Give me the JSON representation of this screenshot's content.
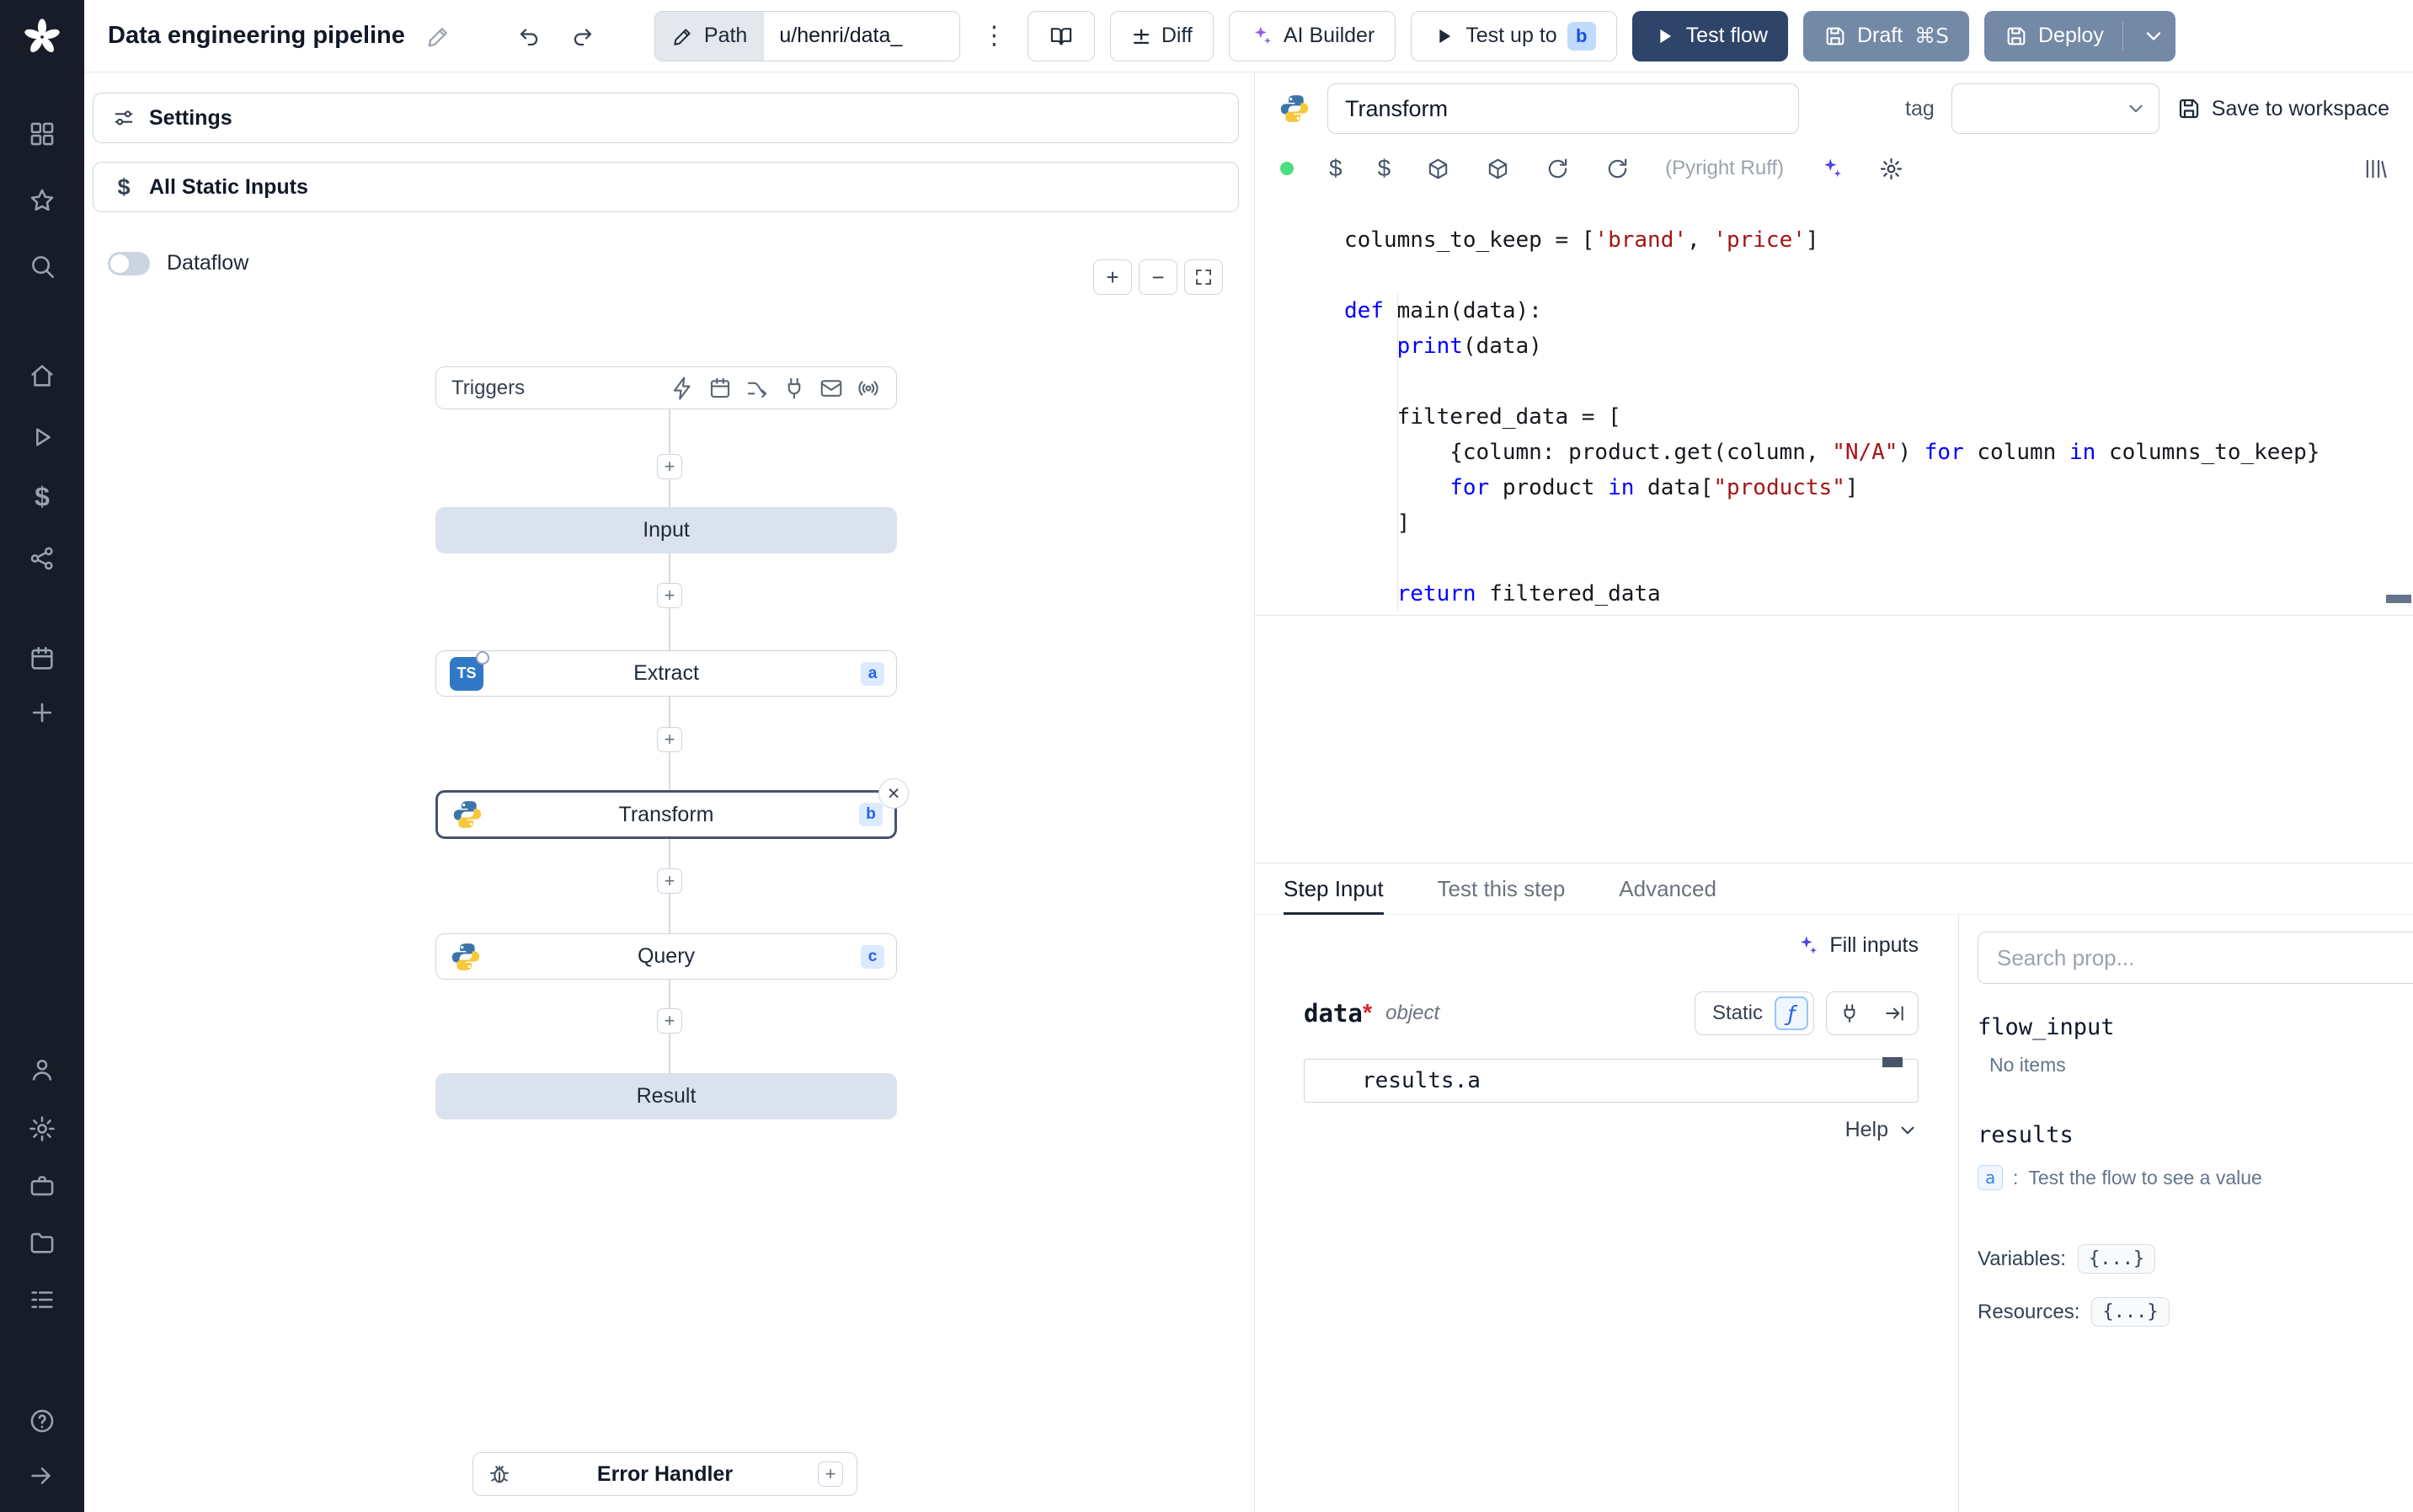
{
  "icons": {
    "kebab": "⋮",
    "plus": "+",
    "minus": "−",
    "close": "×",
    "dollar": "$",
    "fn": "ƒ",
    "ts_label": "TS",
    "diff_glyph": "±"
  },
  "topbar": {
    "title": "Data engineering pipeline",
    "path": {
      "label": "Path",
      "value": "u/henri/data_"
    },
    "buttons": {
      "diff": "Diff",
      "ai_builder": "AI Builder",
      "test_up_to": "Test up to",
      "test_up_to_badge": "b",
      "test_flow": "Test flow",
      "draft": "Draft",
      "draft_shortcut": "⌘S",
      "deploy": "Deploy"
    }
  },
  "flow": {
    "settings": "Settings",
    "all_static_inputs": "All Static Inputs",
    "dataflow": "Dataflow",
    "triggers": "Triggers",
    "nodes": {
      "input": "Input",
      "extract": {
        "label": "Extract",
        "badge": "a"
      },
      "transform": {
        "label": "Transform",
        "badge": "b"
      },
      "query": {
        "label": "Query",
        "badge": "c"
      },
      "result": "Result"
    },
    "error_handler": "Error Handler"
  },
  "editor": {
    "step_name": "Transform",
    "tag_label": "tag",
    "save_to_workspace": "Save to workspace",
    "lint": "(Pyright Ruff)",
    "code_lines": [
      [
        {
          "c": "p",
          "t": "columns_to_keep = ["
        },
        {
          "c": "s",
          "t": "'brand'"
        },
        {
          "c": "p",
          "t": ", "
        },
        {
          "c": "s",
          "t": "'price'"
        },
        {
          "c": "p",
          "t": "]"
        }
      ],
      [],
      [
        {
          "c": "k",
          "t": "def"
        },
        {
          "c": "p",
          "t": " main(data):"
        }
      ],
      [
        {
          "c": "p",
          "t": "    "
        },
        {
          "c": "k",
          "t": "print"
        },
        {
          "c": "p",
          "t": "(data)"
        }
      ],
      [],
      [
        {
          "c": "p",
          "t": "    filtered_data = ["
        }
      ],
      [
        {
          "c": "p",
          "t": "        {column: product.get(column, "
        },
        {
          "c": "s",
          "t": "\"N/A\""
        },
        {
          "c": "p",
          "t": ") "
        },
        {
          "c": "k",
          "t": "for"
        },
        {
          "c": "p",
          "t": " column "
        },
        {
          "c": "k",
          "t": "in"
        },
        {
          "c": "p",
          "t": " columns_to_keep}"
        }
      ],
      [
        {
          "c": "p",
          "t": "        "
        },
        {
          "c": "k",
          "t": "for"
        },
        {
          "c": "p",
          "t": " product "
        },
        {
          "c": "k",
          "t": "in"
        },
        {
          "c": "p",
          "t": " data["
        },
        {
          "c": "s",
          "t": "\"products\""
        },
        {
          "c": "p",
          "t": "]"
        }
      ],
      [
        {
          "c": "p",
          "t": "    ]"
        }
      ],
      [],
      [
        {
          "c": "p",
          "t": "    "
        },
        {
          "c": "k",
          "t": "return"
        },
        {
          "c": "p",
          "t": " filtered_data"
        }
      ]
    ]
  },
  "step_panel": {
    "tabs": [
      "Step Input",
      "Test this step",
      "Advanced"
    ],
    "fill_inputs": "Fill inputs",
    "arg": {
      "name": "data",
      "required_mark": "*",
      "type": "object"
    },
    "static_label": "Static",
    "expr_value": "results.a",
    "help": "Help"
  },
  "props": {
    "search_placeholder": "Search prop...",
    "flow_input_title": "flow_input",
    "flow_input_empty": "No items",
    "results_title": "results",
    "result_badge": "a",
    "result_sep": ":",
    "result_hint": "Test the flow to see a value",
    "variables_label": "Variables:",
    "variables_value": "{...}",
    "resources_label": "Resources:",
    "resources_value": "{...}"
  },
  "colors": {
    "accent_blue": "#2563eb",
    "dark_button": "#2e4468",
    "slate_button": "#7389a6",
    "badge_bg": "#dbeafe",
    "python_blue": "#3b74a9",
    "python_yellow": "#f7c83d",
    "status_green": "#4ade80"
  }
}
